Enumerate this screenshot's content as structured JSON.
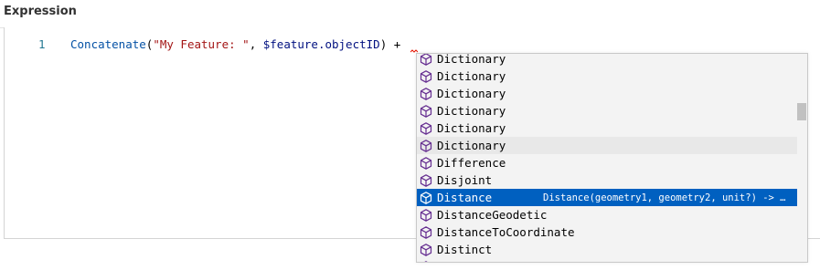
{
  "header": {
    "title": "Expression"
  },
  "editor": {
    "line_number": "1",
    "tokens": {
      "fn": "Concatenate",
      "open": "(",
      "str": "\"My Feature: \"",
      "sep": ", ",
      "var": "$feature.objectID",
      "close": ") +"
    }
  },
  "suggest": {
    "items": [
      {
        "label": "Dictionary",
        "icon": "cube-icon"
      },
      {
        "label": "Dictionary",
        "icon": "cube-icon"
      },
      {
        "label": "Dictionary",
        "icon": "cube-icon"
      },
      {
        "label": "Dictionary",
        "icon": "cube-icon"
      },
      {
        "label": "Dictionary",
        "icon": "cube-icon"
      },
      {
        "label": "Dictionary",
        "icon": "cube-icon"
      },
      {
        "label": "Difference",
        "icon": "cube-icon"
      },
      {
        "label": "Disjoint",
        "icon": "cube-icon"
      },
      {
        "label": "Distance",
        "icon": "cube-icon",
        "detail": "Distance(geometry1, geometry2, unit?) -> …",
        "selected": true
      },
      {
        "label": "DistanceGeodetic",
        "icon": "cube-icon"
      },
      {
        "label": "DistanceToCoordinate",
        "icon": "cube-icon"
      },
      {
        "label": "Distinct",
        "icon": "cube-icon"
      },
      {
        "label": "Distinct",
        "icon": "cube-icon"
      }
    ],
    "hovered_index": 5,
    "selected_color": "#0060c0",
    "icon_color": "#652d90"
  }
}
